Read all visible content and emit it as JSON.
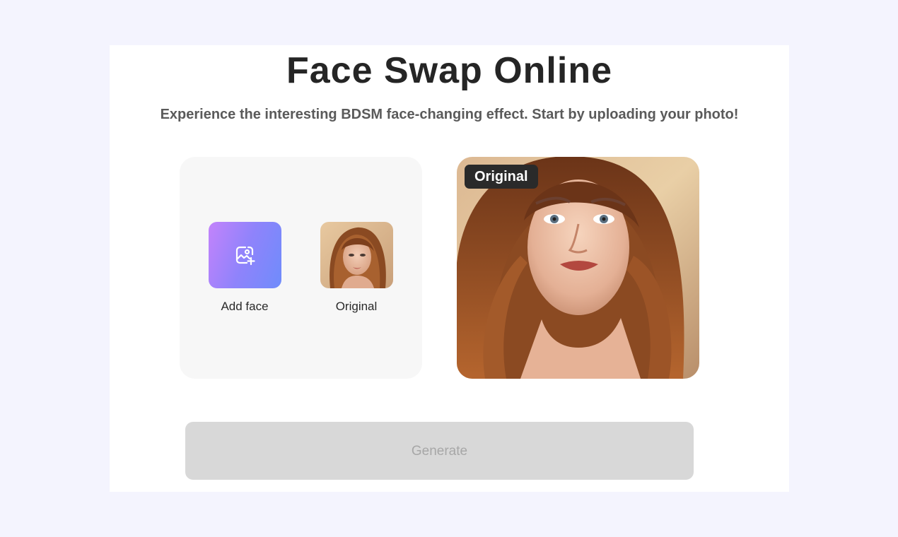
{
  "header": {
    "title": "Face Swap Online",
    "subtitle": "Experience the interesting BDSM face-changing effect. Start by uploading your photo!"
  },
  "face_panel": {
    "add_face_label": "Add face",
    "add_face_icon": "image-plus-icon",
    "original_label": "Original"
  },
  "preview": {
    "badge": "Original"
  },
  "actions": {
    "generate_label": "Generate",
    "generate_enabled": false
  },
  "colors": {
    "page_background": "#f4f4fe",
    "card_background": "#ffffff",
    "panel_background": "#f7f7f7",
    "add_face_gradient_start": "#c383fb",
    "add_face_gradient_end": "#6f8cfb",
    "badge_background": "#2a2a2a",
    "generate_disabled_background": "#d8d8d8",
    "generate_disabled_text": "#a7a7a7"
  }
}
